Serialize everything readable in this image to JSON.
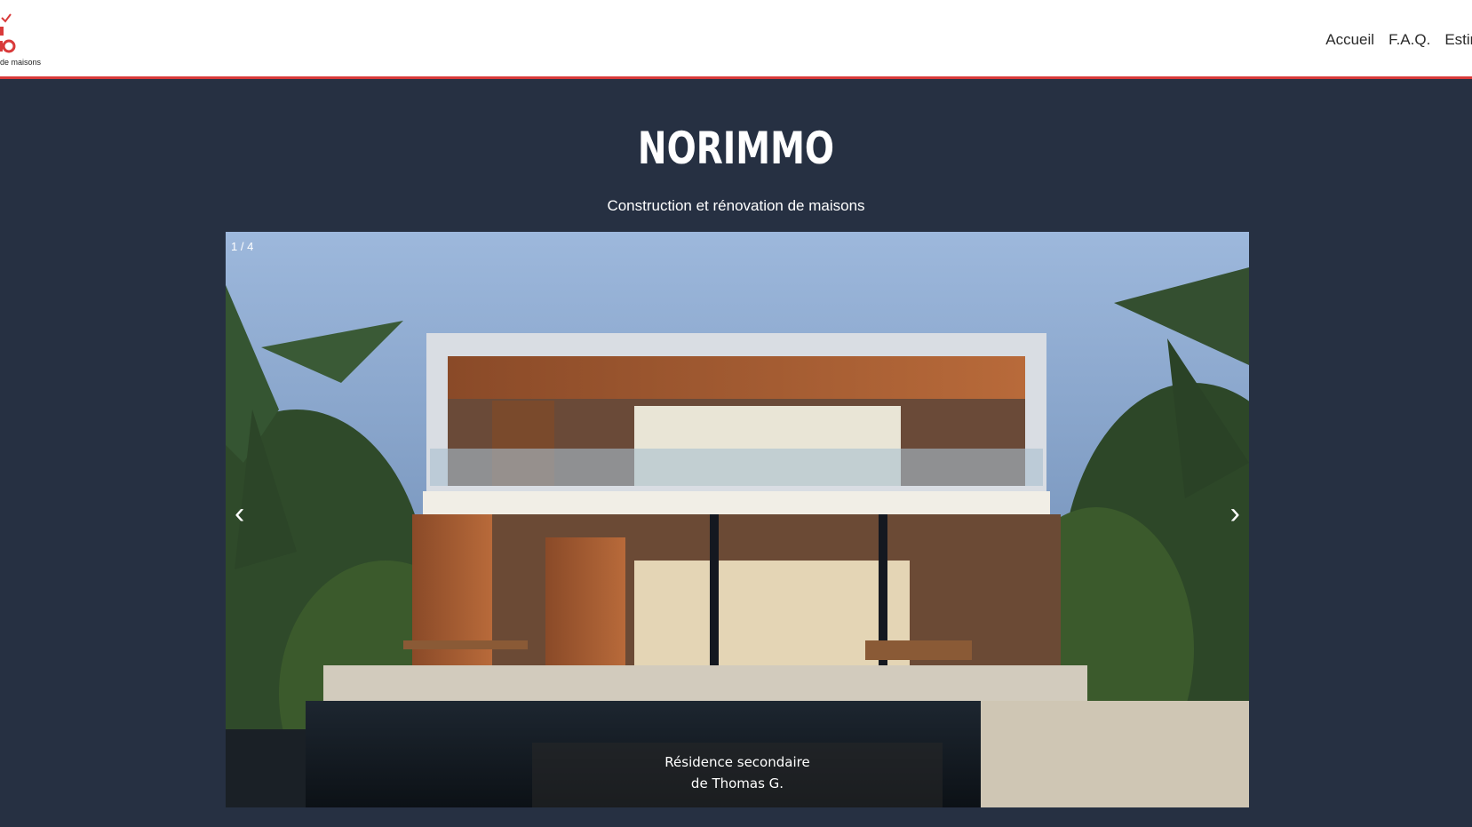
{
  "header": {
    "logo_tagline": "de maisons",
    "nav": [
      {
        "label": "Accueil"
      },
      {
        "label": "F.A.Q."
      },
      {
        "label": "Estimat"
      }
    ]
  },
  "hero": {
    "title": "NORIMMO",
    "subtitle": "Construction et rénovation de maisons"
  },
  "slideshow": {
    "counter": "1 / 4",
    "prev_symbol": "‹",
    "next_symbol": "›",
    "caption_line1": "Résidence secondaire",
    "caption_line2": "de Thomas G."
  },
  "colors": {
    "page_bg": "#263042",
    "header_accent": "#d93a3a"
  }
}
